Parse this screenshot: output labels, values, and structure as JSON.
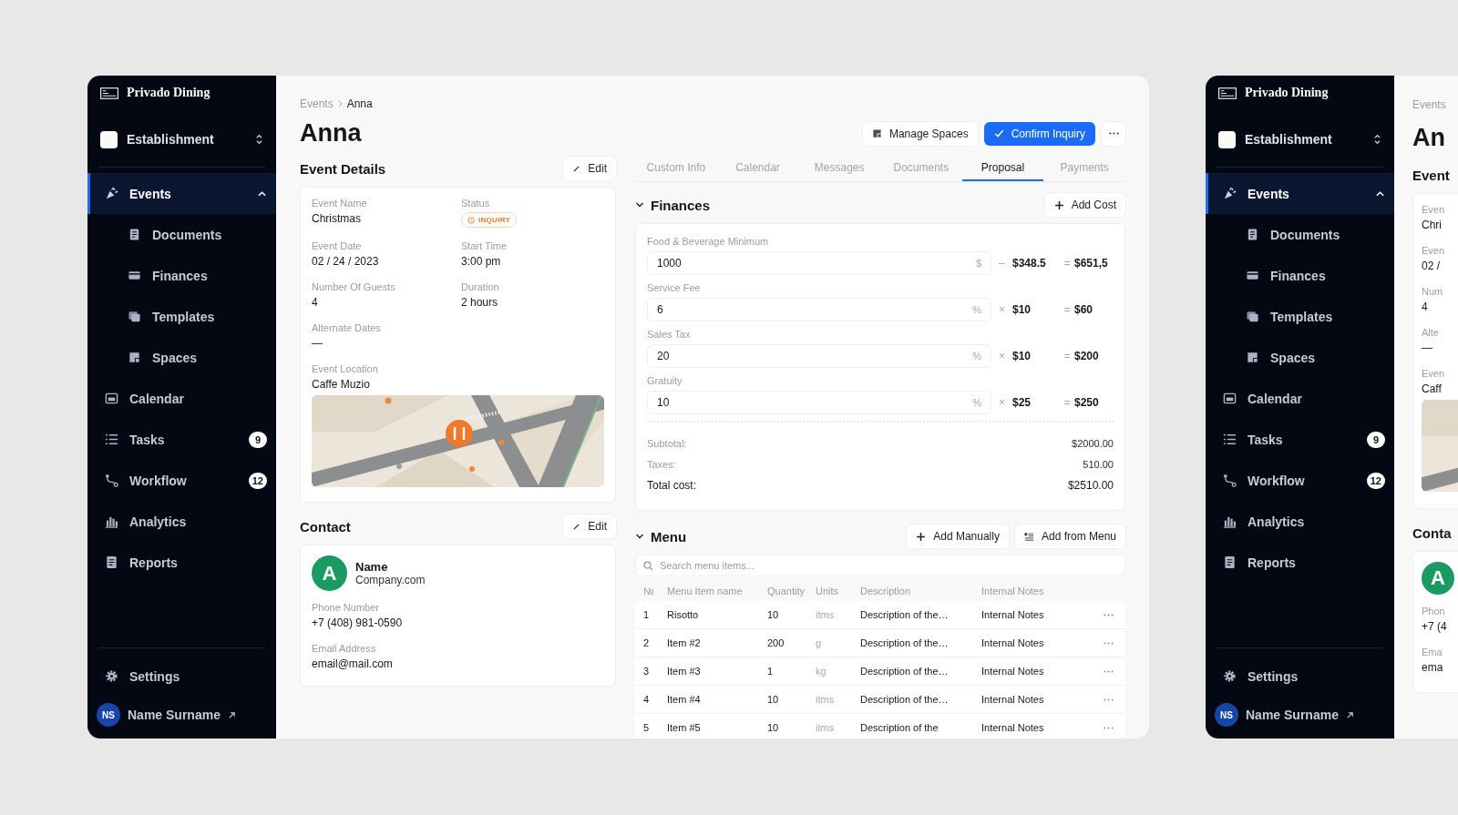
{
  "windows": [
    {
      "sidebar": {
        "brand": "Privado Dining",
        "workspace": "Establishment",
        "nav": [
          {
            "label": "Events",
            "selected": true,
            "expanded": true,
            "children": [
              {
                "label": "Documents",
                "selected": false
              },
              {
                "label": "Finances",
                "selected": false
              },
              {
                "label": "Templates",
                "selected": false
              },
              {
                "label": "Spaces",
                "selected": false
              }
            ]
          },
          {
            "label": "Calendar",
            "selected": false
          },
          {
            "label": "Tasks",
            "selected": false,
            "badge": "9"
          },
          {
            "label": "Workflow",
            "selected": false,
            "badge": "12"
          },
          {
            "label": "Analytics",
            "selected": false
          },
          {
            "label": "Reports",
            "selected": false
          }
        ],
        "settings": "Settings",
        "user": {
          "initials": "NS",
          "name": "Name Surname"
        }
      },
      "main": {
        "breadcrumb": [
          "Events",
          "Anna"
        ],
        "title": "Anna",
        "actions": [
          {
            "label": "Manage Spaces",
            "kind": "secondary"
          },
          {
            "label": "Confirm Inquiry",
            "kind": "primary"
          }
        ],
        "event_details": {
          "heading": "Event Details",
          "edit": "Edit",
          "fields": [
            {
              "label": "Event Name",
              "value": "Christmas",
              "kind": "text"
            },
            {
              "label": "Status",
              "value": "INQUIRY",
              "kind": "status"
            },
            {
              "label": "Event Date",
              "value": "02 / 24 / 2023",
              "kind": "text"
            },
            {
              "label": "Start Time",
              "value": "3:00 pm",
              "kind": "text"
            },
            {
              "label": "Number Of Guests",
              "value": "4",
              "kind": "text"
            },
            {
              "label": "Duration",
              "value": "2 hours",
              "kind": "text"
            },
            {
              "label": "Alternate Dates",
              "value": "—",
              "kind": "text"
            }
          ],
          "location": {
            "label": "Event Location",
            "value": "Caffe Muzio"
          }
        },
        "contact": {
          "heading": "Contact",
          "edit": "Edit",
          "avatar": "A",
          "name": "Name",
          "company": "Company.com",
          "fields": [
            {
              "label": "Phone Number",
              "value": "+7 (408) 981-0590"
            },
            {
              "label": "Email Address",
              "value": "email@mail.com"
            }
          ]
        },
        "tabs": [
          {
            "label": "Custom Info",
            "selected": false
          },
          {
            "label": "Calendar",
            "selected": false
          },
          {
            "label": "Messages",
            "selected": false
          },
          {
            "label": "Documents",
            "selected": false
          },
          {
            "label": "Proposal",
            "selected": true
          },
          {
            "label": "Payments",
            "selected": false
          }
        ],
        "finances": {
          "heading": "Finances",
          "expanded": true,
          "add": "Add Cost",
          "rows": [
            {
              "label": "Food & Beverage Minimum",
              "value": "1000",
              "unit": "$",
              "op": "–",
              "factor": "$348.5",
              "eq": "=",
              "result": "$651,5"
            },
            {
              "label": "Service Fee",
              "value": "6",
              "unit": "%",
              "op": "×",
              "factor": "$10",
              "eq": "=",
              "result": "$60"
            },
            {
              "label": "Sales Tax",
              "value": "20",
              "unit": "%",
              "op": "×",
              "factor": "$10",
              "eq": "=",
              "result": "$200"
            },
            {
              "label": "Gratuity",
              "value": "10",
              "unit": "%",
              "op": "×",
              "factor": "$25",
              "eq": "=",
              "result": "$250"
            }
          ],
          "totals": [
            {
              "label": "Subtotal:",
              "value": "$2000.00",
              "kind": "line"
            },
            {
              "label": "Taxes:",
              "value": "510.00",
              "kind": "line"
            },
            {
              "label": "Total cost:",
              "value": "$2510.00",
              "kind": "total"
            }
          ]
        },
        "menu": {
          "heading": "Menu",
          "expanded": true,
          "actions": [
            {
              "label": "Add Manually",
              "kind": "plus"
            },
            {
              "label": "Add from Menu",
              "kind": "list"
            }
          ],
          "search": {
            "placeholder": "Search menu items..."
          },
          "table": {
            "columns": [
              "№",
              "Menu Item name",
              "Quantity",
              "Units",
              "Description",
              "Internal Notes"
            ],
            "rows": [
              {
                "cells": [
                  "1",
                  "Risotto",
                  "10",
                  "itms",
                  "Description of the…",
                  "Internal Notes"
                ]
              },
              {
                "cells": [
                  "2",
                  "Item #2",
                  "200",
                  "g",
                  "Description of the…",
                  "Internal Notes"
                ]
              },
              {
                "cells": [
                  "3",
                  "Item #3",
                  "1",
                  "kg",
                  "Description of the…",
                  "Internal Notes"
                ]
              },
              {
                "cells": [
                  "4",
                  "Item #4",
                  "10",
                  "itms",
                  "Description of the…",
                  "Internal Notes"
                ]
              },
              {
                "cells": [
                  "5",
                  "Item #5",
                  "10",
                  "itms",
                  "Description of the",
                  "Internal Notes"
                ]
              }
            ]
          }
        }
      }
    },
    {
      "sidebar": {
        "brand": "Privado Dining",
        "workspace": "Establishment",
        "nav": [
          {
            "label": "Events",
            "selected": true,
            "expanded": true,
            "children": [
              {
                "label": "Documents",
                "selected": false
              },
              {
                "label": "Finances",
                "selected": false
              },
              {
                "label": "Templates",
                "selected": false
              },
              {
                "label": "Spaces",
                "selected": false
              }
            ]
          },
          {
            "label": "Calendar",
            "selected": false
          },
          {
            "label": "Tasks",
            "selected": false,
            "badge": "9"
          },
          {
            "label": "Workflow",
            "selected": false,
            "badge": "12"
          },
          {
            "label": "Analytics",
            "selected": false
          },
          {
            "label": "Reports",
            "selected": false
          }
        ],
        "settings": "Settings",
        "user": {
          "initials": "NS",
          "name": "Name Surname"
        }
      },
      "main_visible": {
        "breadcrumb": "Events",
        "title": "An",
        "details_heading": "Event",
        "fields": [
          {
            "label": "Even",
            "value": "Chri"
          },
          {
            "label": "Even",
            "value": "02 /"
          },
          {
            "label": "Num",
            "value": "4"
          },
          {
            "label": "Alte",
            "value": "—"
          }
        ],
        "location": {
          "label": "Even",
          "value": "Caff"
        },
        "contact_heading": "Conta",
        "avatar": "A",
        "contact_fields": [
          {
            "label": "Phon",
            "value": "+7 (4"
          },
          {
            "label": "Ema",
            "value": "ema"
          }
        ]
      }
    }
  ]
}
